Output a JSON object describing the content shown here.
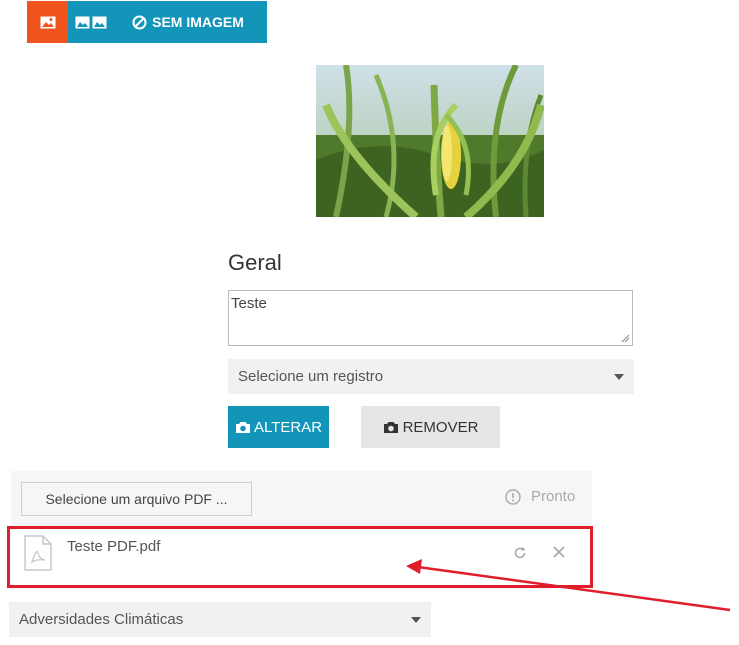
{
  "toolbar": {
    "single_image_icon": "image-icon",
    "double_image_icon": "images-icon",
    "no_image_label": "SEM IMAGEM",
    "no_image_icon": "ban-icon",
    "accent_active": "#f0541e",
    "accent": "#1395ba"
  },
  "section": {
    "title": "Geral",
    "text_value": "Teste",
    "select_placeholder": "Selecione um registro"
  },
  "actions": {
    "alterar_label": "ALTERAR",
    "remover_label": "REMOVER"
  },
  "upload": {
    "choose_label": "Selecione um arquivo PDF ...",
    "status_label": "Pronto",
    "file_name": "Teste PDF.pdf",
    "file_icon": "pdf-file-icon"
  },
  "adversidades": {
    "selected": "Adversidades Climáticas"
  },
  "annotation": {
    "highlight_color": "#e01e2b"
  }
}
